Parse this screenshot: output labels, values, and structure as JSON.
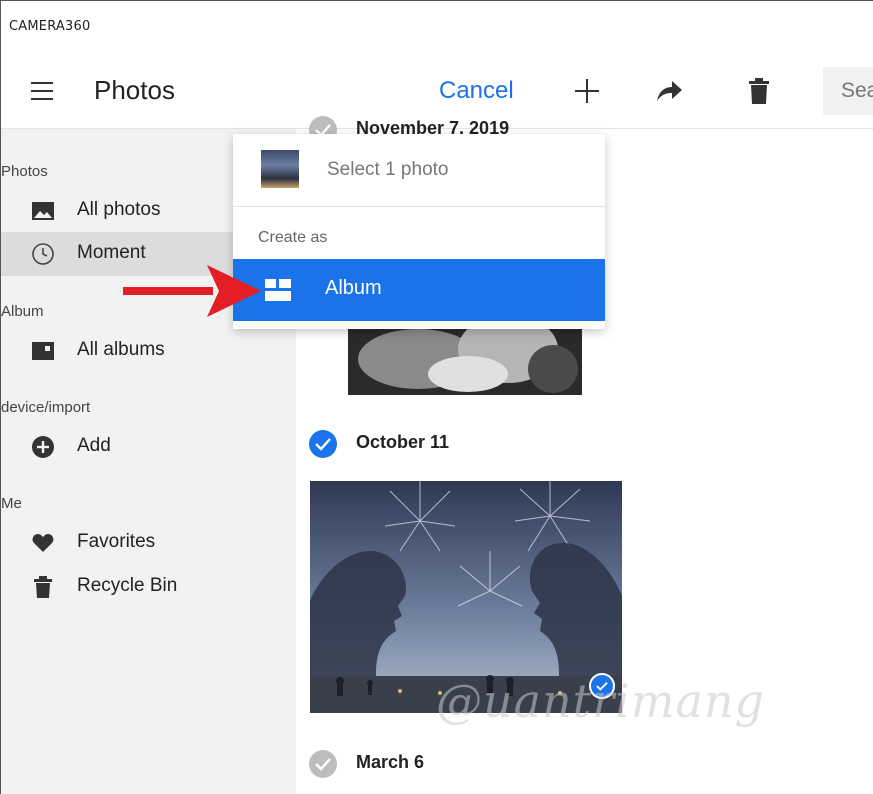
{
  "app": {
    "title": "CAMERA360"
  },
  "header": {
    "title": "Photos",
    "cancel_label": "Cancel",
    "icons": [
      "menu-icon",
      "plus-icon",
      "share-icon",
      "trash-icon"
    ],
    "search_placeholder": "Search"
  },
  "sidebar": {
    "sections": [
      {
        "label": "Photos"
      },
      {
        "label": "Album"
      },
      {
        "label": "device/import"
      },
      {
        "label": "Me"
      }
    ],
    "items": [
      {
        "label": "All photos",
        "icon": "image-icon"
      },
      {
        "label": "Moment",
        "icon": "clock-icon",
        "active": true
      },
      {
        "label": "All albums",
        "icon": "album-icon"
      },
      {
        "label": "Add",
        "icon": "add-circle-icon"
      },
      {
        "label": "Favorites",
        "icon": "heart-icon"
      },
      {
        "label": "Recycle Bin",
        "icon": "trash-icon"
      }
    ]
  },
  "content": {
    "groups": [
      {
        "date": "November 7, 2019",
        "selected": false
      },
      {
        "date": "October 11",
        "selected": true
      },
      {
        "date": "March 6",
        "selected": false
      }
    ],
    "watermark": "@uantrimang"
  },
  "dropdown": {
    "select_label": "Select 1 photo",
    "create_as_label": "Create as",
    "album_label": "Album"
  },
  "colors": {
    "accent": "#1a73e8",
    "sidebar_bg": "#f2f2f2",
    "active_item_bg": "#dcdcdc",
    "arrow": "#e31e24"
  }
}
